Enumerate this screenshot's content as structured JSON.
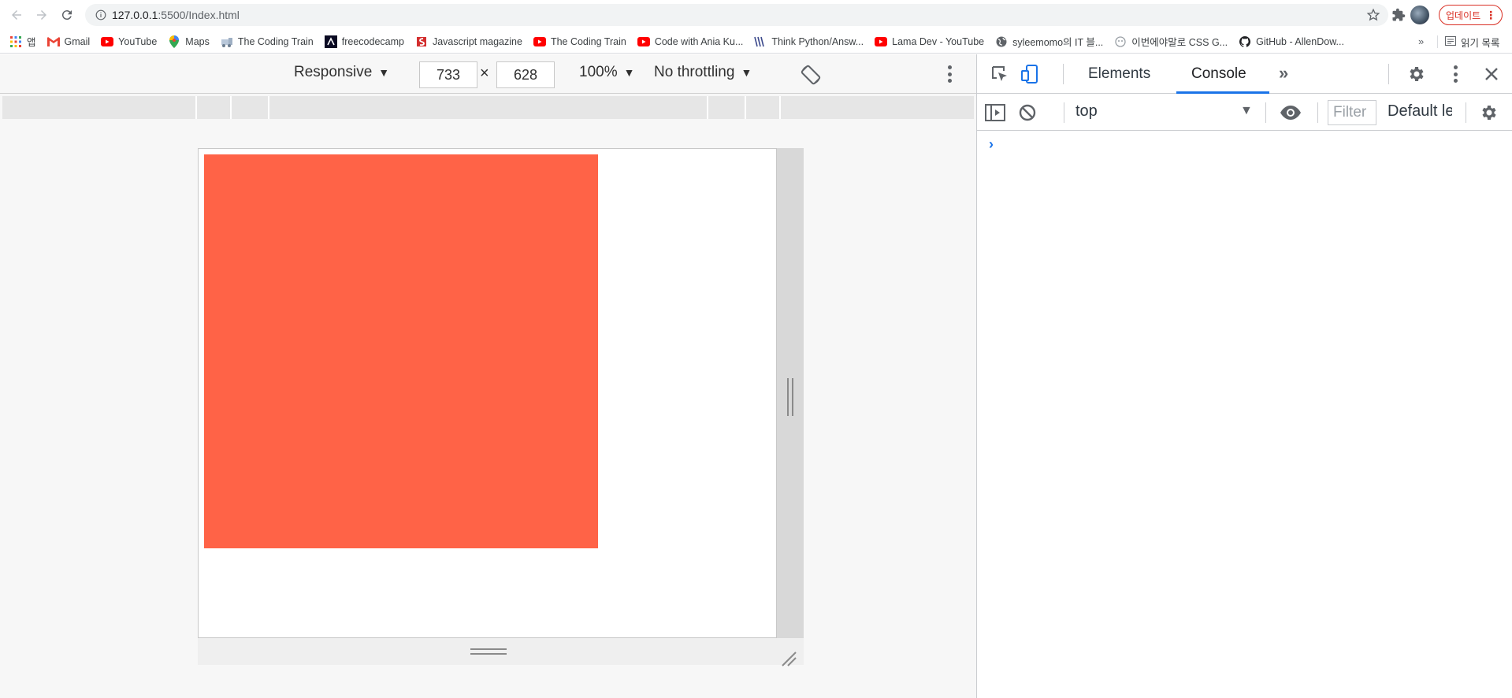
{
  "browser": {
    "url_host": "127.0.0.1",
    "url_rest": ":5500/Index.html",
    "update_label": "업데이트",
    "bookmarks": [
      {
        "label": "앱",
        "icon": "apps-grid-icon"
      },
      {
        "label": "Gmail",
        "icon": "gmail-icon"
      },
      {
        "label": "YouTube",
        "icon": "youtube-icon"
      },
      {
        "label": "Maps",
        "icon": "maps-pin-icon"
      },
      {
        "label": "The Coding Train",
        "icon": "coding-train-icon"
      },
      {
        "label": "freecodecamp",
        "icon": "freecodecamp-icon"
      },
      {
        "label": "Javascript magazine",
        "icon": "javascript-magazine-icon"
      },
      {
        "label": "The Coding Train",
        "icon": "youtube-icon"
      },
      {
        "label": "Code with Ania Ku...",
        "icon": "youtube-icon"
      },
      {
        "label": "Think Python/Answ...",
        "icon": "think-python-icon"
      },
      {
        "label": "Lama Dev - YouTube",
        "icon": "youtube-icon"
      },
      {
        "label": "syleemomo의 IT 블...",
        "icon": "globe-icon"
      },
      {
        "label": "이번에야말로 CSS G...",
        "icon": "ghost-icon"
      },
      {
        "label": "GitHub - AllenDow...",
        "icon": "github-icon"
      }
    ],
    "bookmarks_overflow": "»",
    "reading_list_label": "읽기 목록"
  },
  "device_toolbar": {
    "device_mode": "Responsive",
    "width": "733",
    "times": "×",
    "height": "628",
    "zoom": "100%",
    "throttling": "No throttling"
  },
  "page": {
    "box_color": "#ff6347"
  },
  "devtools": {
    "tabs": [
      "Elements",
      "Console"
    ],
    "active_tab": "Console",
    "more_tabs": "»",
    "context": "top",
    "filter_placeholder": "Filter",
    "levels": "Default levels",
    "prompt": "›",
    "accent_color": "#1a73e8"
  }
}
